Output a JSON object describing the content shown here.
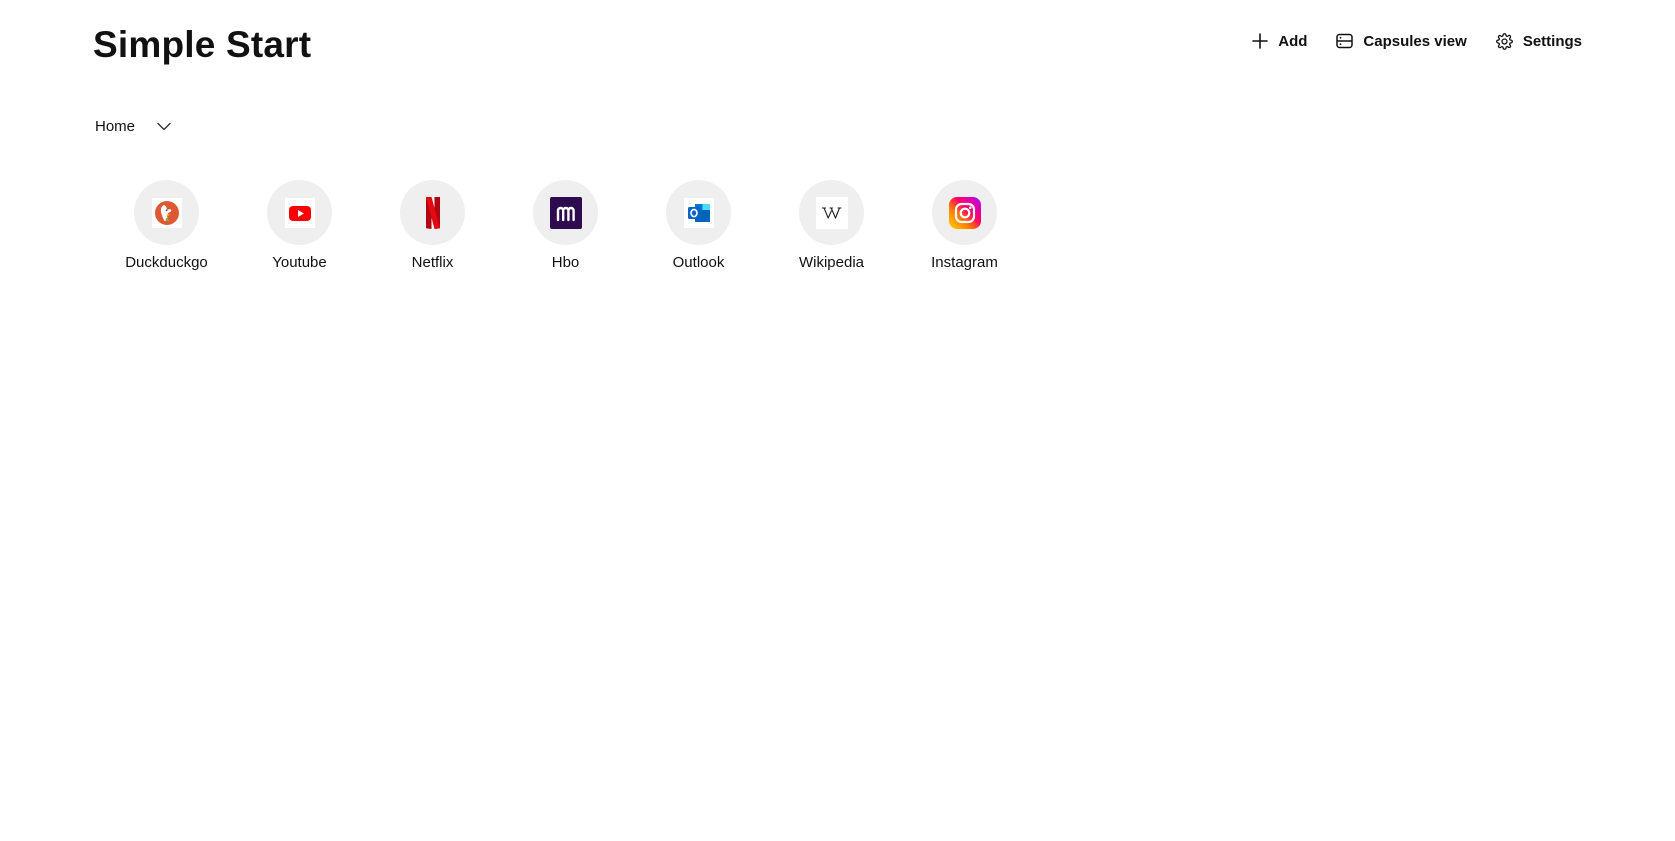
{
  "header": {
    "title": "Simple Start",
    "actions": [
      {
        "label": "Add",
        "icon": "plus-icon"
      },
      {
        "label": "Capsules view",
        "icon": "capsules-view-icon"
      },
      {
        "label": "Settings",
        "icon": "gear-icon"
      }
    ]
  },
  "group_selector": {
    "selected": "Home",
    "icon": "chevron-down-icon"
  },
  "shortcuts": [
    {
      "label": "Duckduckgo",
      "icon": "duckduckgo-icon",
      "color": "#de5833"
    },
    {
      "label": "Youtube",
      "icon": "youtube-icon",
      "color": "#ff0000"
    },
    {
      "label": "Netflix",
      "icon": "netflix-icon",
      "color": "#e50914"
    },
    {
      "label": "Hbo",
      "icon": "hbo-max-icon",
      "color": "#2e0a4f"
    },
    {
      "label": "Outlook",
      "icon": "outlook-icon",
      "color": "#0a64c8"
    },
    {
      "label": "Wikipedia",
      "icon": "wikipedia-icon",
      "color": "#333333"
    },
    {
      "label": "Instagram",
      "icon": "instagram-icon",
      "color": "#d6249f"
    }
  ],
  "colors": {
    "bubble_background": "#efefef",
    "text": "#111111"
  }
}
